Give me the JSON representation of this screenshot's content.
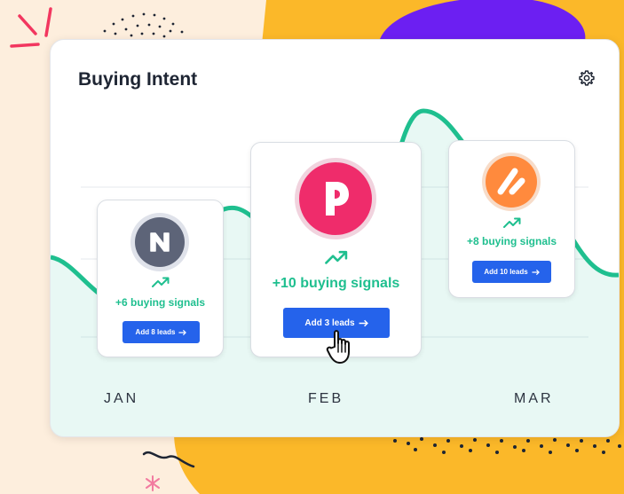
{
  "widget": {
    "title": "Buying Intent",
    "settings_icon": "gear-icon"
  },
  "months": [
    "JAN",
    "FEB",
    "MAR"
  ],
  "cards": [
    {
      "logo_icon": "n-logo-icon",
      "logo_color": "#5d6478",
      "trend_icon": "trending-up-icon",
      "signals": "+6 buying signals",
      "button_label": "Add 8 leads",
      "button_icon": "arrow-right-icon"
    },
    {
      "logo_icon": "p-logo-icon",
      "logo_color": "#ef2c6b",
      "trend_icon": "trending-up-icon",
      "signals": "+10 buying signals",
      "button_label": "Add 3 leads",
      "button_icon": "arrow-right-icon"
    },
    {
      "logo_icon": "a-logo-icon",
      "logo_color": "#ff8a3d",
      "trend_icon": "trending-up-icon",
      "signals": "+8 buying signals",
      "button_label": "Add 10 leads",
      "button_icon": "arrow-right-icon"
    }
  ],
  "colors": {
    "accent_green": "#1fbf8f",
    "button_blue": "#2563eb",
    "background_yellow": "#fbb829",
    "background_purple": "#6c1ff2"
  }
}
